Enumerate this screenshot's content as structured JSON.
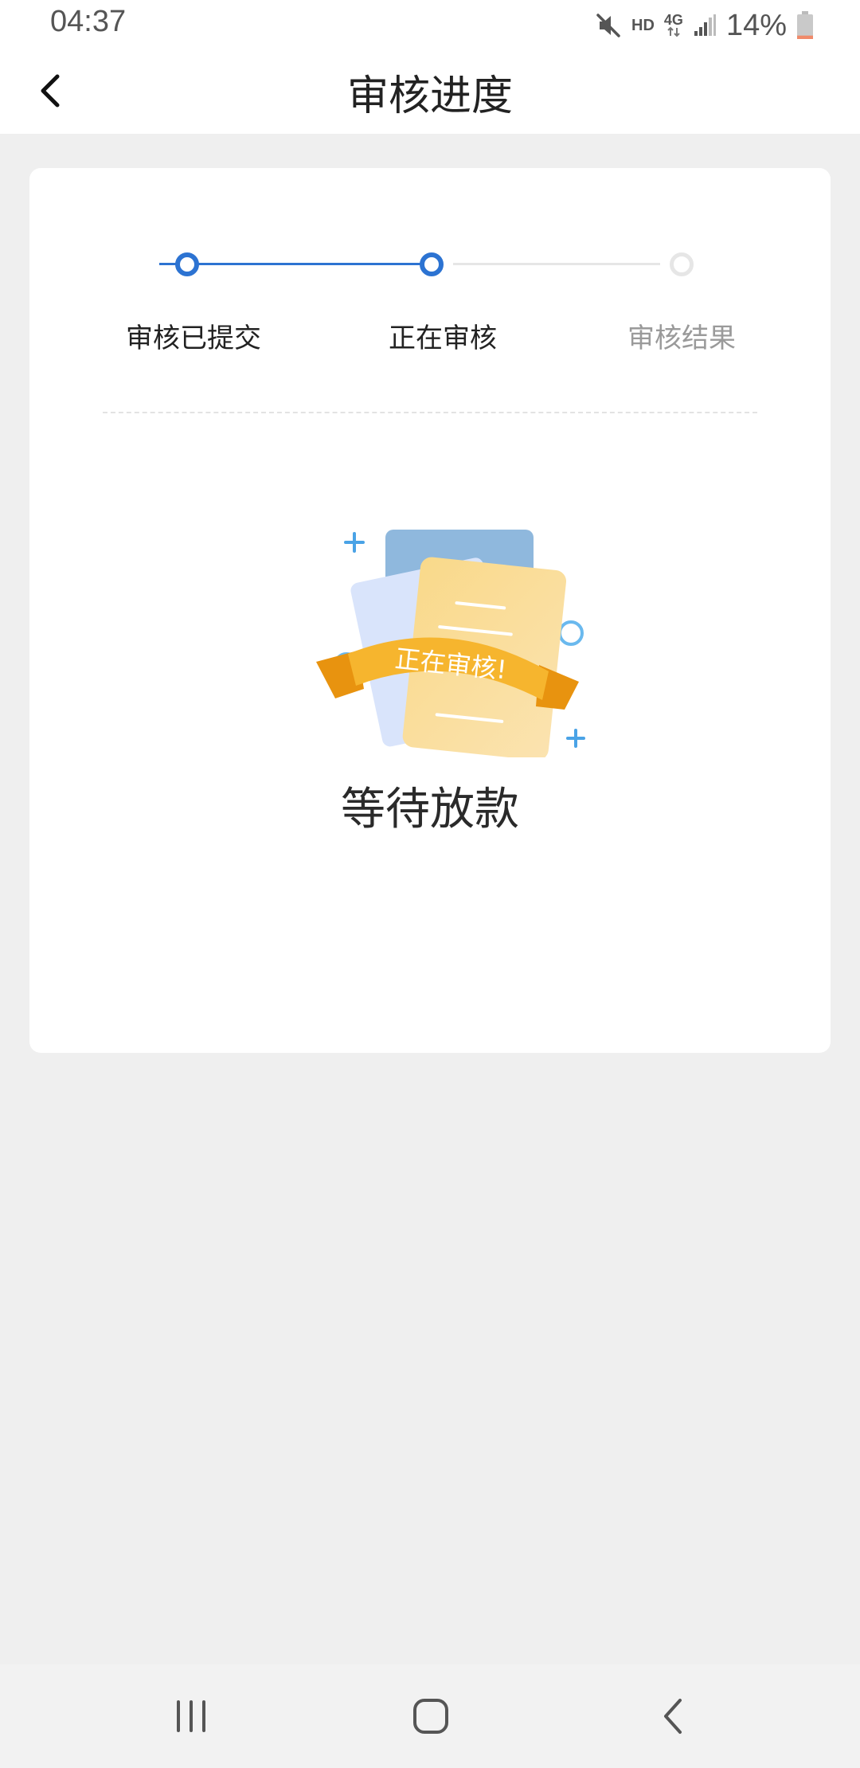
{
  "status_bar": {
    "time": "04:37",
    "hd_label": "HD",
    "network_label": "4G",
    "battery_percent": "14%",
    "battery_level": 0.14,
    "icons": [
      "mute-icon",
      "signal-icon",
      "battery-icon"
    ]
  },
  "app_bar": {
    "title": "审核进度",
    "back_icon": "chevron-left-icon"
  },
  "steps": [
    {
      "label": "审核已提交",
      "state": "done"
    },
    {
      "label": "正在审核",
      "state": "current"
    },
    {
      "label": "审核结果",
      "state": "pending"
    }
  ],
  "illustration": {
    "ribbon_text": "正在审核!"
  },
  "status_message": "等待放款",
  "colors": {
    "accent": "#2c73d2",
    "inactive": "#e6e6e6",
    "ribbon": "#f6b52e"
  },
  "nav_bar": {
    "icons": [
      "recent-apps-icon",
      "home-icon",
      "back-icon"
    ]
  }
}
